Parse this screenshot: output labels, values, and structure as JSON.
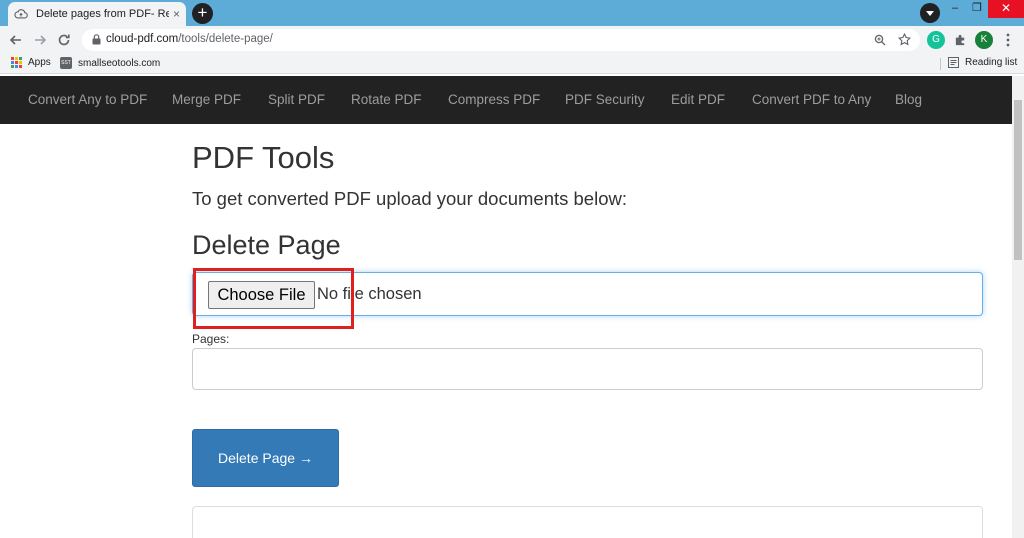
{
  "browser": {
    "tab_title": "Delete pages from PDF- Remove",
    "tab_close": "×",
    "new_tab": "+",
    "win_min": "–",
    "win_max": "❐",
    "win_close": "✕",
    "url_domain": "cloud-pdf.com",
    "url_path": "/tools/delete-page/",
    "extension_g": "G",
    "profile_initial": "K",
    "colors": {
      "tabstrip": "#5dacd8",
      "grammarly": "#15c39a",
      "profile": "#188038"
    }
  },
  "bookmarks": {
    "apps": "Apps",
    "smallseo_badge": "SST",
    "smallseo": "smallseotools.com",
    "reading_list": "Reading list"
  },
  "nav": {
    "items": [
      "Convert Any to PDF",
      "Merge PDF",
      "Split PDF",
      "Rotate PDF",
      "Compress PDF",
      "PDF Security",
      "Edit PDF",
      "Convert PDF to Any",
      "Blog"
    ]
  },
  "content": {
    "title": "PDF Tools",
    "lead": "To get converted PDF upload your documents below:",
    "section_title": "Delete Page",
    "file_button": "Choose File",
    "file_status": "No file chosen",
    "pages_label": "Pages:",
    "pages_value": "",
    "submit_label": "Delete Page →",
    "colors": {
      "primary_button": "#337ab7",
      "focus_border": "#66afe9",
      "highlight_box": "#e0201c",
      "nav_bg": "#222222"
    }
  }
}
